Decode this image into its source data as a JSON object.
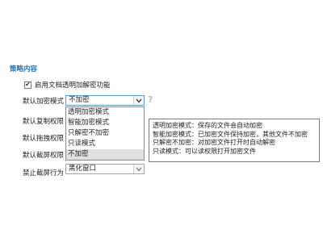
{
  "section": {
    "title": "策略内容"
  },
  "enable_transparent": {
    "label": "启用文档透明加解密功能",
    "checked": true,
    "check_mark": "✔"
  },
  "fields": {
    "default_encrypt": {
      "label": "默认加密模式",
      "value": "不加密"
    },
    "default_copy": {
      "label": "默认复制权限"
    },
    "default_drag": {
      "label": "默认拖拽权限"
    },
    "default_screenshot": {
      "label": "默认截屏权限"
    },
    "forbid_screenshot": {
      "label": "禁止截屏行为",
      "value": "黑化窗口"
    }
  },
  "dropdown": {
    "options": [
      "透明加密模式",
      "智能加密模式",
      "只解密不加密",
      "只读模式",
      "不加密"
    ],
    "selected_index": 4
  },
  "help": {
    "symbol": "?"
  },
  "tooltip": {
    "lines": [
      "透明加密模式：保存的文件会自动加密",
      "智能加密模式：已加密文件保持加密，其他文件不加密",
      "只解密不加密：对加密文件打开时自动解密",
      "只读模式：可以读权限打开加密文件"
    ]
  },
  "colors": {
    "section_title": "#2e74b5",
    "selected_option_bg": "#e0e0e0",
    "focus_border": "#5b9bd5"
  }
}
